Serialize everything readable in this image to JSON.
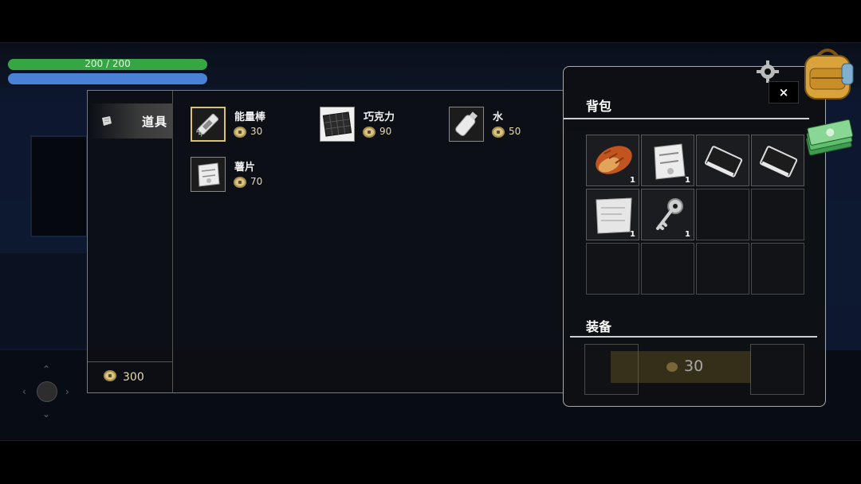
{
  "hud": {
    "hp_text": "200 / 200",
    "hp_fraction": 1.0,
    "mp_fraction": 1.0,
    "hp_color": "#36a642",
    "mp_color": "#4a80d6"
  },
  "shop": {
    "tabs": [
      {
        "label": "道具",
        "icon": "paper-scrap-icon",
        "selected": true
      }
    ],
    "wallet_amount": "300",
    "items": [
      {
        "name": "能量棒",
        "price": "30",
        "icon": "energy-bar-icon",
        "selected": true
      },
      {
        "name": "巧克力",
        "price": "90",
        "icon": "chocolate-icon",
        "selected": false
      },
      {
        "name": "水",
        "price": "50",
        "icon": "water-bottle-icon",
        "selected": false
      },
      {
        "name": "薯片",
        "price": "70",
        "icon": "chips-bag-icon",
        "selected": false
      }
    ]
  },
  "backpack": {
    "title": "背包",
    "close_label": "×",
    "slots": [
      {
        "icon": "bread-icon",
        "count": "1"
      },
      {
        "icon": "chips-bag-icon",
        "count": "1"
      },
      {
        "icon": "book-icon",
        "count": ""
      },
      {
        "icon": "book-icon",
        "count": ""
      },
      {
        "icon": "paper-note-icon",
        "count": "1"
      },
      {
        "icon": "key-icon",
        "count": "1"
      }
    ],
    "equip_title": "装备",
    "equip_banner_value": "30"
  },
  "colors": {
    "accent_gold": "#d8c27a",
    "panel_border": "#aaaaaa"
  }
}
